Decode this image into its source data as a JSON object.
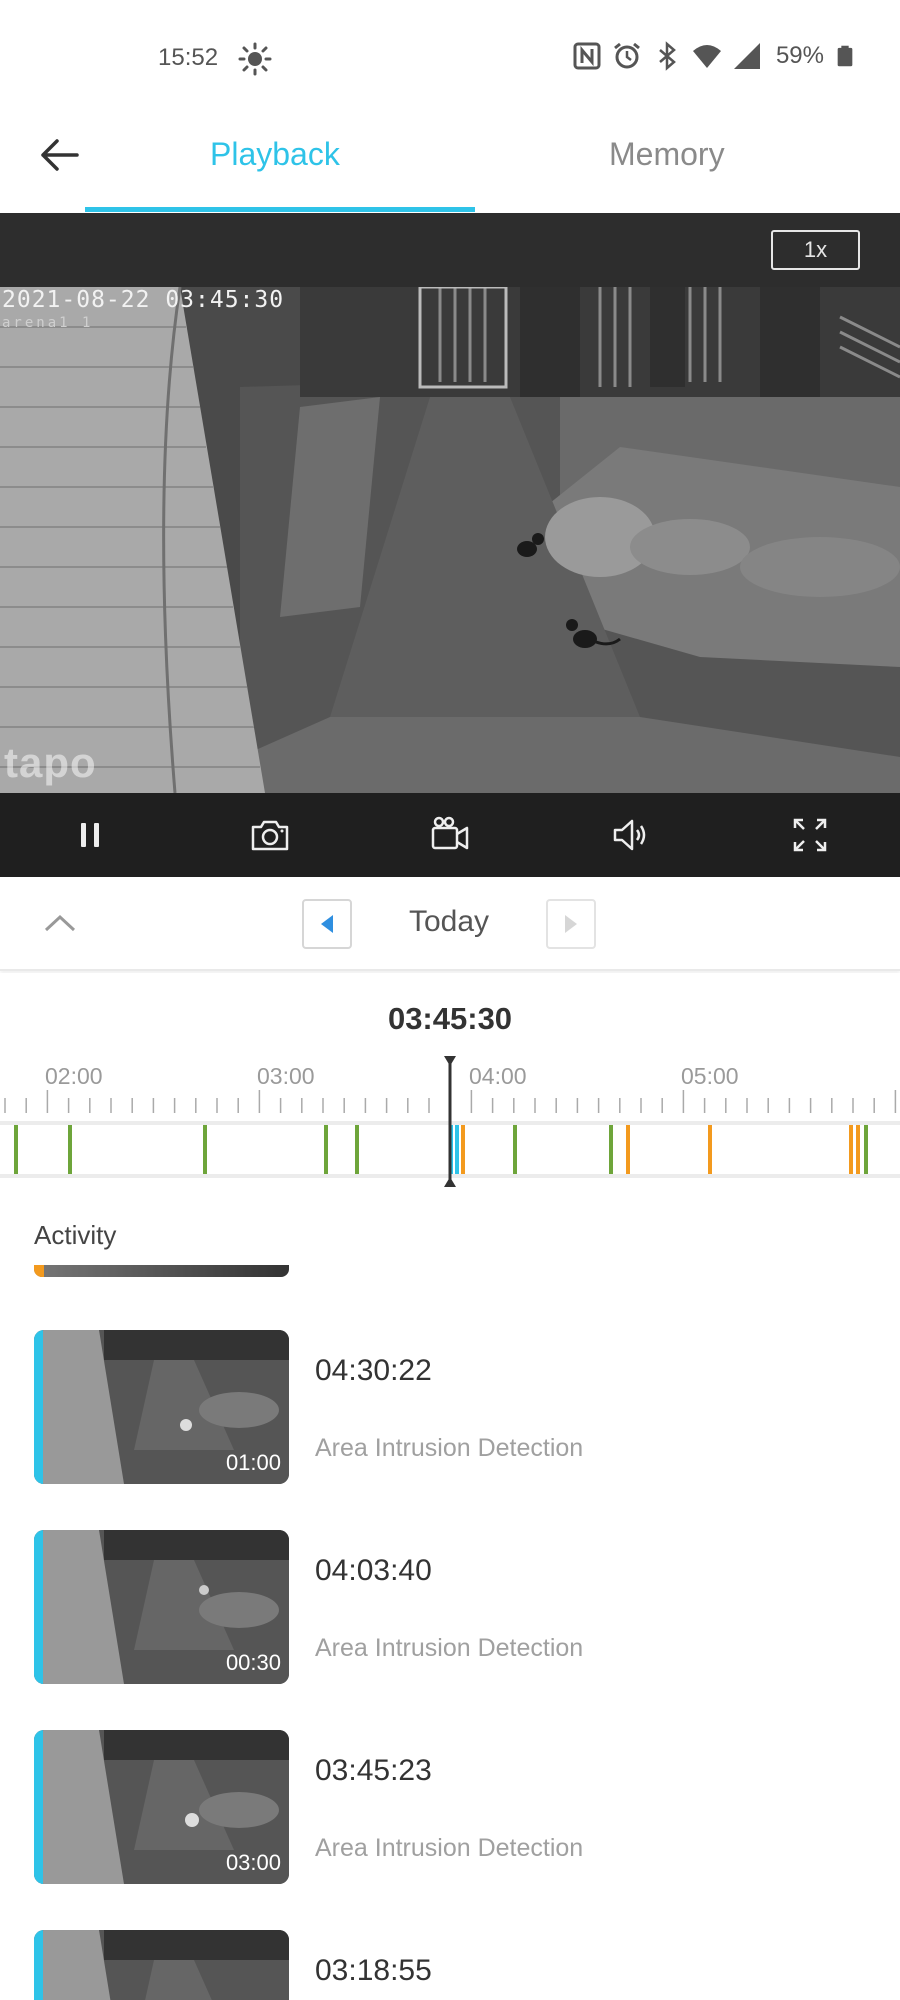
{
  "status_bar": {
    "time": "15:52",
    "battery": "59%",
    "icons": [
      "sun-icon",
      "nfc-icon",
      "alarm-icon",
      "bluetooth-icon",
      "wifi-icon",
      "signal-icon",
      "battery-icon"
    ]
  },
  "header": {
    "back_icon": "arrow-left-icon",
    "tabs": [
      {
        "label": "Playback",
        "active": true
      },
      {
        "label": "Memory",
        "active": false
      }
    ],
    "accent_color": "#2ec3e8"
  },
  "player": {
    "speed": "1x",
    "timestamp": "2021-08-22 03:45:30",
    "camera_name": "arena1 1",
    "watermark": "tapo",
    "controls": [
      "pause-icon",
      "snapshot-camera-icon",
      "record-video-icon",
      "speaker-icon",
      "fullscreen-icon"
    ]
  },
  "date_nav": {
    "label": "Today",
    "prev_icon": "chevron-left-icon",
    "next_icon": "chevron-right-icon",
    "collapse_icon": "chevron-up-icon"
  },
  "timeline": {
    "current_time": "03:45:30",
    "hour_labels": [
      "02:00",
      "03:00",
      "04:00",
      "05:00"
    ],
    "event_colors": {
      "motion": "#6ea53a",
      "intrusion": "#f39a1e",
      "selected": "#2ec3e8"
    }
  },
  "activity": {
    "title": "Activity",
    "items": [
      {
        "time": "04:30:22",
        "type": "Area Intrusion Detection",
        "duration": "01:00"
      },
      {
        "time": "04:03:40",
        "type": "Area Intrusion Detection",
        "duration": "00:30"
      },
      {
        "time": "03:45:23",
        "type": "Area Intrusion Detection",
        "duration": "03:00"
      },
      {
        "time": "03:18:55",
        "type": "",
        "duration": ""
      }
    ]
  }
}
